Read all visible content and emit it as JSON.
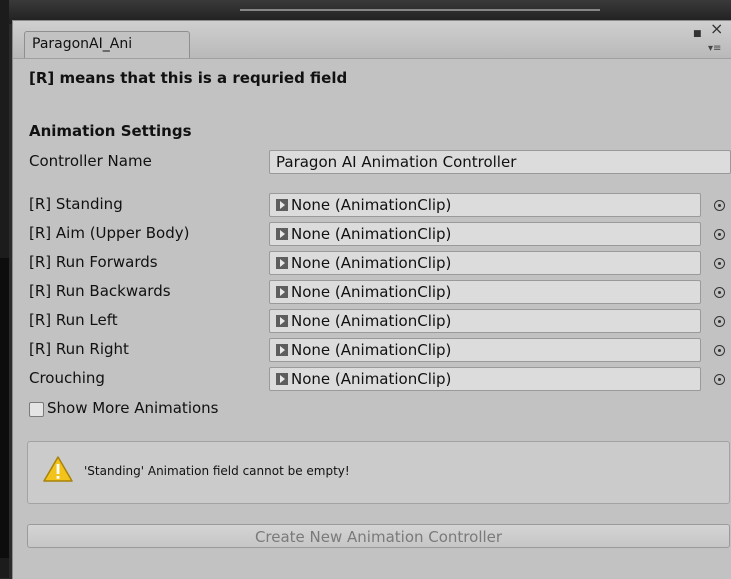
{
  "window": {
    "tab_title": "ParagonAI_Ani",
    "maximize_glyph": "■",
    "close_glyph": "×",
    "menu_glyph": "▾≡"
  },
  "notice": "[R] means that this is a requried field",
  "section_title": "Animation Settings",
  "controller": {
    "label": "Controller Name",
    "value": "Paragon AI Animation Controller"
  },
  "clips": [
    {
      "label": "[R] Standing",
      "value": "None (AnimationClip)"
    },
    {
      "label": "[R] Aim (Upper Body)",
      "value": "None (AnimationClip)"
    },
    {
      "label": "[R] Run Forwards",
      "value": "None (AnimationClip)"
    },
    {
      "label": "[R] Run Backwards",
      "value": "None (AnimationClip)"
    },
    {
      "label": "[R] Run Left",
      "value": "None (AnimationClip)"
    },
    {
      "label": "[R] Run Right",
      "value": "None (AnimationClip)"
    },
    {
      "label": "Crouching",
      "value": "None (AnimationClip)"
    }
  ],
  "show_more": {
    "label": "Show More Animations",
    "checked": false
  },
  "warning": {
    "icon": "warning-icon",
    "message": "'Standing' Animation field cannot be empty!"
  },
  "create_button": "Create New Animation Controller",
  "colors": {
    "window_bg": "#c2c2c2",
    "warning_yellow": "#f2c31b",
    "disabled_text": "#7a7a7a"
  }
}
